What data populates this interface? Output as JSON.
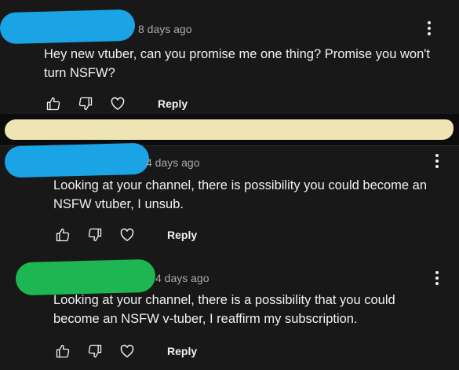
{
  "colors": {
    "background": "#181818",
    "text": "#f1f1f1",
    "meta": "#aaaaaa",
    "redaction_blue": "#1aa4e6",
    "redaction_green": "#1db653",
    "redaction_beige": "#efe4b4"
  },
  "comments": [
    {
      "time": "8 days ago",
      "text": "Hey new vtuber, can you promise me one thing? Promise you won't\nturn NSFW?",
      "reply_label": "Reply",
      "redaction_color": "blue"
    },
    {
      "time": "4 days ago",
      "text": "Looking at your channel, there is possibility you could become an\nNSFW vtuber, I unsub.",
      "reply_label": "Reply",
      "redaction_color": "blue"
    },
    {
      "time": "4 days ago",
      "text": "Looking at your channel, there is a possibility that you could\nbecome an NSFW v-tuber, I reaffirm my subscription.",
      "reply_label": "Reply",
      "redaction_color": "green"
    }
  ],
  "icons": {
    "like": "thumbs-up-icon",
    "dislike": "thumbs-down-icon",
    "heart": "heart-icon",
    "menu": "more-vert-icon"
  }
}
